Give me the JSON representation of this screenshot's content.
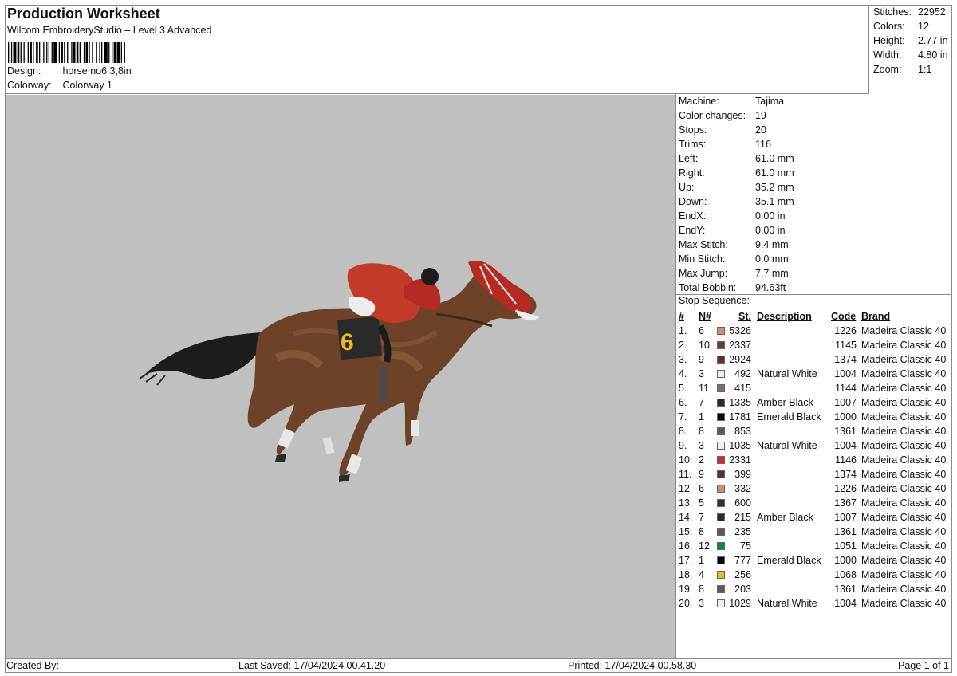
{
  "header": {
    "title": "Production Worksheet",
    "subtitle": "Wilcom EmbroideryStudio – Level 3 Advanced",
    "design_label": "Design:",
    "design_value": "horse no6  3,8in",
    "colorway_label": "Colorway:",
    "colorway_value": "Colorway 1"
  },
  "stats": {
    "stitches_label": "Stitches:",
    "stitches": "22952",
    "colors_label": "Colors:",
    "colors": "12",
    "height_label": "Height:",
    "height": "2.77 in",
    "width_label": "Width:",
    "width": "4.80 in",
    "zoom_label": "Zoom:",
    "zoom": "1:1"
  },
  "machine": [
    {
      "k": "Machine:",
      "v": "Tajima"
    },
    {
      "k": "Color changes:",
      "v": "19"
    },
    {
      "k": "Stops:",
      "v": "20"
    },
    {
      "k": "Trims:",
      "v": "116"
    },
    {
      "k": "Left:",
      "v": "61.0 mm"
    },
    {
      "k": "Right:",
      "v": "61.0 mm"
    },
    {
      "k": "Up:",
      "v": "35.2 mm"
    },
    {
      "k": "Down:",
      "v": "35.1 mm"
    },
    {
      "k": "EndX:",
      "v": "0.00 in"
    },
    {
      "k": "EndY:",
      "v": "0.00 in"
    },
    {
      "k": "Max Stitch:",
      "v": "9.4 mm"
    },
    {
      "k": "Min Stitch:",
      "v": "0.0 mm"
    },
    {
      "k": "Max Jump:",
      "v": "7.7 mm"
    },
    {
      "k": "Total Bobbin:",
      "v": "94.63ft"
    }
  ],
  "stop_sequence": {
    "title": "Stop Sequence:",
    "headers": {
      "idx": "#",
      "n": "N#",
      "st": "St.",
      "desc": "Description",
      "code": "Code",
      "brand": "Brand"
    },
    "rows": [
      {
        "idx": "1.",
        "n": "6",
        "color": "#d08c6a",
        "st": "5326",
        "desc": "",
        "code": "1226",
        "brand": "Madeira Classic 40"
      },
      {
        "idx": "2.",
        "n": "10",
        "color": "#6b3a2e",
        "st": "2337",
        "desc": "",
        "code": "1145",
        "brand": "Madeira Classic 40"
      },
      {
        "idx": "3.",
        "n": "9",
        "color": "#6a2a2a",
        "st": "2924",
        "desc": "",
        "code": "1374",
        "brand": "Madeira Classic 40"
      },
      {
        "idx": "4.",
        "n": "3",
        "color": "#eeeef2",
        "st": "492",
        "desc": "Natural White",
        "code": "1004",
        "brand": "Madeira Classic 40"
      },
      {
        "idx": "5.",
        "n": "11",
        "color": "#8a6a58",
        "st": "415",
        "desc": "",
        "code": "1144",
        "brand": "Madeira Classic 40"
      },
      {
        "idx": "6.",
        "n": "7",
        "color": "#2a2a2a",
        "st": "1335",
        "desc": "Amber Black",
        "code": "1007",
        "brand": "Madeira Classic 40"
      },
      {
        "idx": "7.",
        "n": "1",
        "color": "#050505",
        "st": "1781",
        "desc": "Emerald Black",
        "code": "1000",
        "brand": "Madeira Classic 40"
      },
      {
        "idx": "8.",
        "n": "8",
        "color": "#5a5a5a",
        "st": "853",
        "desc": "",
        "code": "1361",
        "brand": "Madeira Classic 40"
      },
      {
        "idx": "9.",
        "n": "3",
        "color": "#eeeef2",
        "st": "1035",
        "desc": "Natural White",
        "code": "1004",
        "brand": "Madeira Classic 40"
      },
      {
        "idx": "10.",
        "n": "2",
        "color": "#d42a22",
        "st": "2331",
        "desc": "",
        "code": "1146",
        "brand": "Madeira Classic 40"
      },
      {
        "idx": "11.",
        "n": "9",
        "color": "#6a2a2a",
        "st": "399",
        "desc": "",
        "code": "1374",
        "brand": "Madeira Classic 40"
      },
      {
        "idx": "12.",
        "n": "6",
        "color": "#d08c6a",
        "st": "332",
        "desc": "",
        "code": "1226",
        "brand": "Madeira Classic 40"
      },
      {
        "idx": "13.",
        "n": "5",
        "color": "#333333",
        "st": "600",
        "desc": "",
        "code": "1367",
        "brand": "Madeira Classic 40"
      },
      {
        "idx": "14.",
        "n": "7",
        "color": "#2a2a2a",
        "st": "215",
        "desc": "Amber Black",
        "code": "1007",
        "brand": "Madeira Classic 40"
      },
      {
        "idx": "15.",
        "n": "8",
        "color": "#5a5a5a",
        "st": "235",
        "desc": "",
        "code": "1361",
        "brand": "Madeira Classic 40"
      },
      {
        "idx": "16.",
        "n": "12",
        "color": "#0f8a3c",
        "st": "75",
        "desc": "",
        "code": "1051",
        "brand": "Madeira Classic 40"
      },
      {
        "idx": "17.",
        "n": "1",
        "color": "#050505",
        "st": "777",
        "desc": "Emerald Black",
        "code": "1000",
        "brand": "Madeira Classic 40"
      },
      {
        "idx": "18.",
        "n": "4",
        "color": "#f2b81c",
        "st": "256",
        "desc": "",
        "code": "1068",
        "brand": "Madeira Classic 40"
      },
      {
        "idx": "19.",
        "n": "8",
        "color": "#5a5a5a",
        "st": "203",
        "desc": "",
        "code": "1361",
        "brand": "Madeira Classic 40"
      },
      {
        "idx": "20.",
        "n": "3",
        "color": "#eeeef2",
        "st": "1029",
        "desc": "Natural White",
        "code": "1004",
        "brand": "Madeira Classic 40"
      }
    ]
  },
  "footer": {
    "created_by": "Created By:",
    "last_saved": "Last Saved: 17/04/2024 00.41.20",
    "printed": "Printed: 17/04/2024 00.58.30",
    "page": "Page 1 of 1"
  },
  "preview": {
    "background": "#c0c0c0",
    "saddle_number": "6"
  }
}
